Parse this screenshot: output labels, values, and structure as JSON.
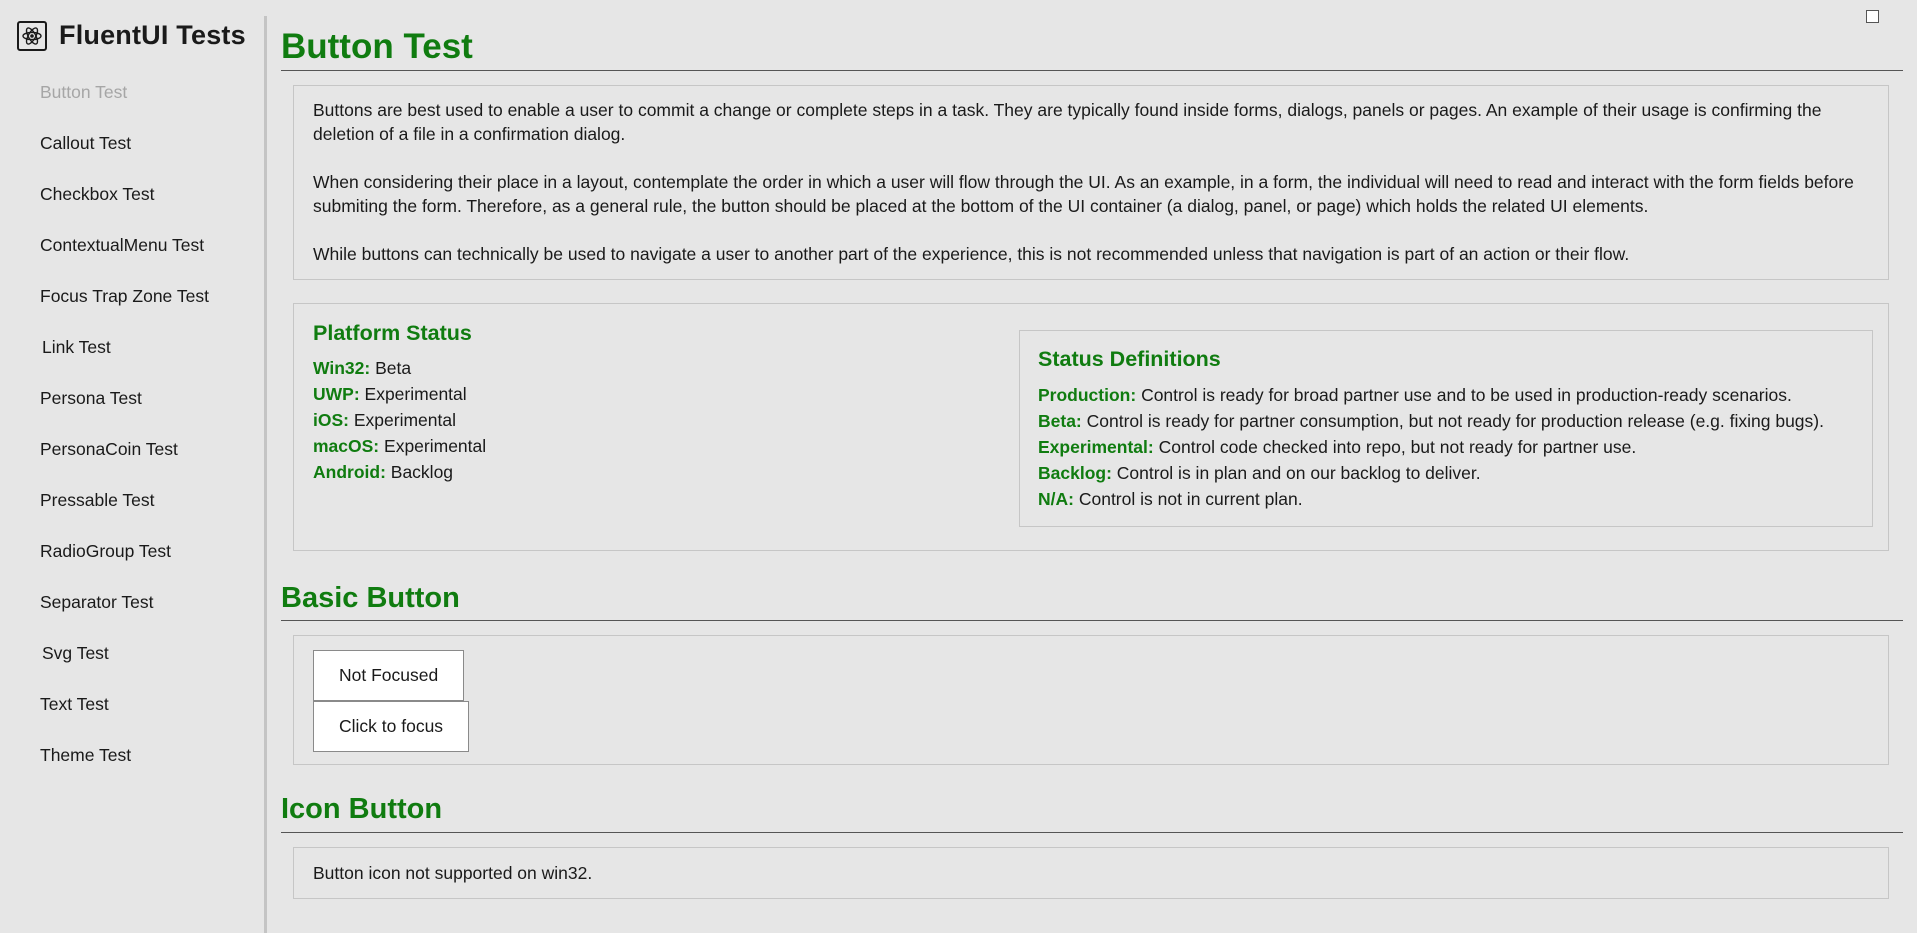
{
  "app": {
    "title": "FluentUI Tests",
    "logo_icon": "atom-icon"
  },
  "sidebar": {
    "items": [
      {
        "label": "Button Test",
        "disabled": true
      },
      {
        "label": "Callout Test"
      },
      {
        "label": "Checkbox Test"
      },
      {
        "label": "ContextualMenu Test"
      },
      {
        "label": "Focus Trap Zone Test"
      },
      {
        "label": "Link Test"
      },
      {
        "label": "Persona Test"
      },
      {
        "label": "PersonaCoin Test"
      },
      {
        "label": "Pressable Test"
      },
      {
        "label": "RadioGroup Test"
      },
      {
        "label": "Separator Test"
      },
      {
        "label": "Svg Test"
      },
      {
        "label": "Text Test"
      },
      {
        "label": "Theme Test"
      }
    ]
  },
  "page": {
    "title": "Button Test",
    "description": [
      "Buttons are best used to enable a user to commit a change or complete steps in a task. They are typically found inside forms, dialogs, panels or pages. An example of their usage is confirming the deletion of a file in a confirmation dialog.",
      "When considering their place in a layout, contemplate the order in which a user will flow through the UI. As an example, in a form, the individual will need to read and interact with the form fields before submiting the form. Therefore, as a general rule, the button should be placed at the bottom of the UI container (a dialog, panel, or page) which holds the related UI elements.",
      "While buttons can technically be used to navigate a user to another part of the experience, this is not recommended unless that navigation is part of an action or their flow."
    ]
  },
  "platform_status": {
    "title": "Platform Status",
    "items": [
      {
        "platform": "Win32:",
        "status": "Beta"
      },
      {
        "platform": "UWP:",
        "status": "Experimental"
      },
      {
        "platform": "iOS:",
        "status": "Experimental"
      },
      {
        "platform": "macOS:",
        "status": "Experimental"
      },
      {
        "platform": "Android:",
        "status": "Backlog"
      }
    ]
  },
  "status_definitions": {
    "title": "Status Definitions",
    "items": [
      {
        "term": "Production:",
        "definition": "Control is ready for broad partner use and to be used in production-ready scenarios."
      },
      {
        "term": "Beta:",
        "definition": "Control is ready for partner consumption, but not ready for production release (e.g. fixing bugs)."
      },
      {
        "term": "Experimental:",
        "definition": "Control code checked into repo, but not ready for partner use."
      },
      {
        "term": "Backlog:",
        "definition": "Control is in plan and on our backlog to deliver."
      },
      {
        "term": "N/A:",
        "definition": "Control is not in current plan."
      }
    ]
  },
  "basic_button": {
    "title": "Basic Button",
    "buttons": [
      "Not Focused",
      "Click to focus"
    ]
  },
  "icon_button": {
    "title": "Icon Button",
    "message": "Button icon not supported on win32."
  },
  "colors": {
    "accent": "#107c10",
    "background": "#e6e6e6",
    "disabled_text": "#a6a6a6"
  }
}
